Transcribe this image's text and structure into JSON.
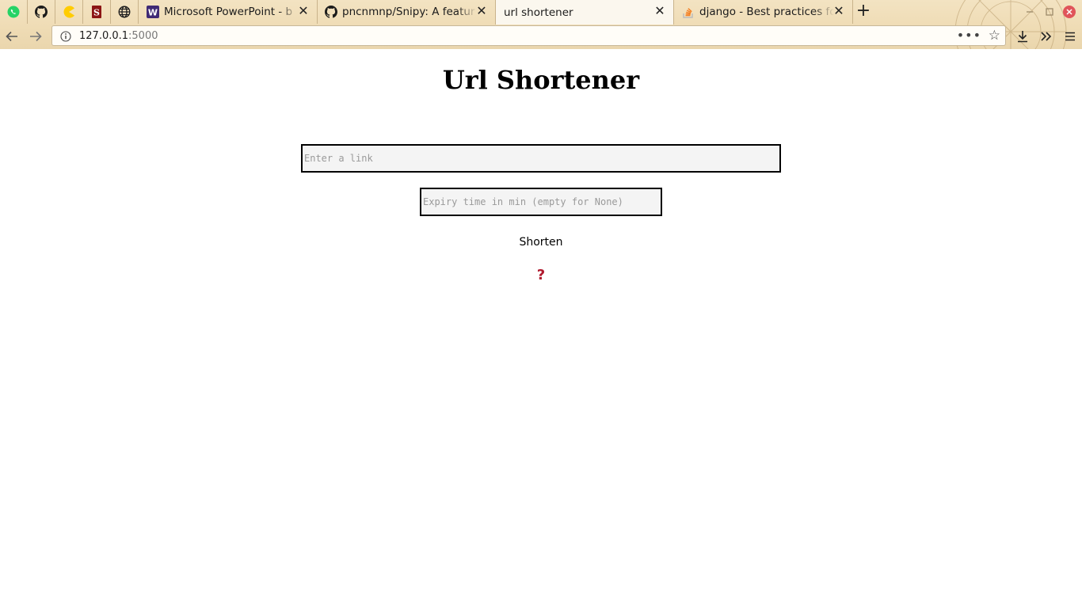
{
  "browser": {
    "tabs": [
      {
        "icon": "whatsapp-icon",
        "pinned": true
      },
      {
        "icon": "github-icon",
        "pinned": true
      },
      {
        "icon": "pacman-icon",
        "pinned": true
      },
      {
        "icon": "stanford-icon",
        "pinned": true
      },
      {
        "icon": "globe-icon",
        "pinned": true
      },
      {
        "icon": "word-icon",
        "title": "Microsoft PowerPoint - b"
      },
      {
        "icon": "github-icon",
        "title": "pncnmnp/Snipy: A featur"
      },
      {
        "icon": "none",
        "title": "url shortener",
        "active": true
      },
      {
        "icon": "stackoverflow-icon",
        "title": "django - Best practices fo"
      }
    ],
    "address": {
      "host": "127.0.0.1",
      "port": ":5000"
    },
    "colors": {
      "chrome": "#efdcb5",
      "close_button": "#e0545a"
    }
  },
  "page": {
    "heading": "Url Shortener",
    "link_input": {
      "placeholder": "Enter a link",
      "value": ""
    },
    "expiry_input": {
      "placeholder": "Expiry time in min (empty for None)",
      "value": ""
    },
    "shorten_label": "Shorten",
    "help_label": "?",
    "colors": {
      "help": "#b01a2e",
      "input_bg": "#f4f4f4"
    }
  }
}
